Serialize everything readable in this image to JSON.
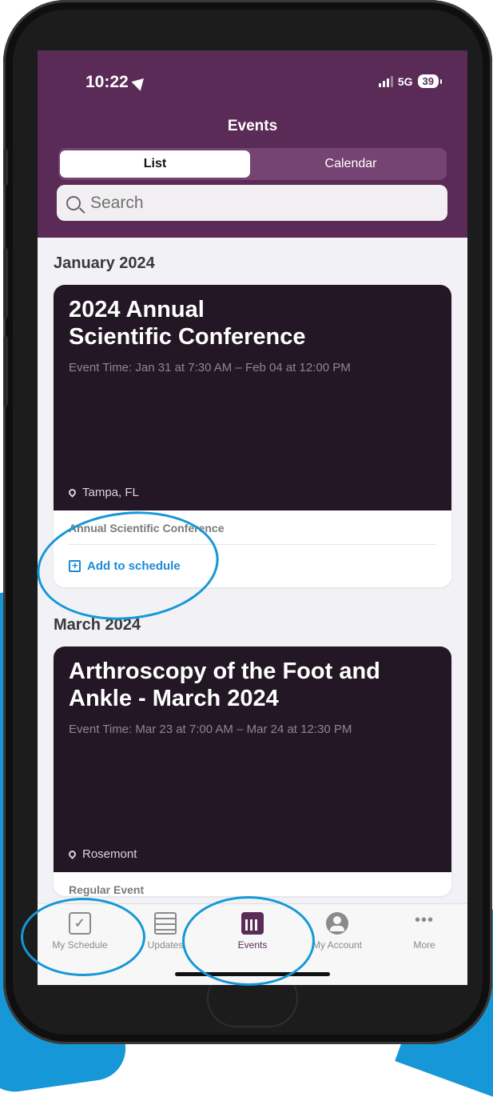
{
  "status_bar": {
    "time": "10:22",
    "network": "5G",
    "battery": "39"
  },
  "header": {
    "title": "Events",
    "segments": [
      {
        "label": "List"
      },
      {
        "label": "Calendar"
      }
    ]
  },
  "search": {
    "placeholder": "Search"
  },
  "sections": [
    {
      "month": "January 2024",
      "event": {
        "title_line1": "2024 Annual",
        "title_line2": "Scientific Conference",
        "time": "Event Time: Jan 31 at 7:30 AM – Feb 04 at 12:00 PM",
        "location": "Tampa, FL",
        "type": "Annual Scientific Conference",
        "action": "Add to schedule"
      }
    },
    {
      "month": "March 2024",
      "event": {
        "title_line1": "Arthroscopy of the Foot and",
        "title_line2": "Ankle - March 2024",
        "time": "Event Time: Mar 23 at 7:00 AM – Mar 24 at 12:30 PM",
        "location": "Rosemont",
        "type": "Regular Event"
      }
    }
  ],
  "tab_bar": [
    {
      "label": "My Schedule",
      "icon": "calendar-check-icon"
    },
    {
      "label": "Updates",
      "icon": "news-icon"
    },
    {
      "label": "Events",
      "icon": "calendar-grid-icon"
    },
    {
      "label": "My Account",
      "icon": "person-icon"
    },
    {
      "label": "More",
      "icon": "more-dots-icon"
    }
  ],
  "colors": {
    "header": "#5b2b57",
    "banner": "#241725",
    "accent": "#1a8bd6",
    "annotation": "#1597d8"
  }
}
